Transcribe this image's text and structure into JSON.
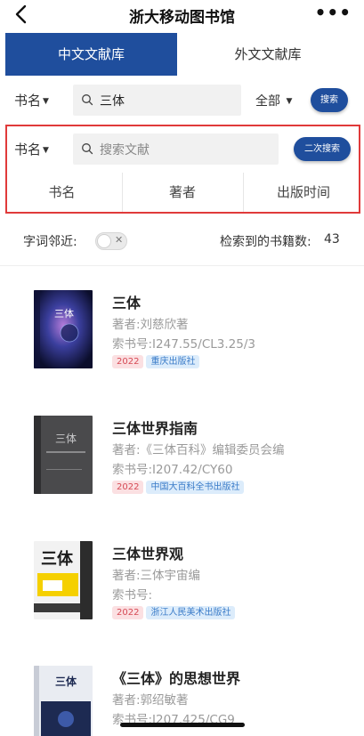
{
  "header": {
    "title": "浙大移动图书馆",
    "more_label": "•••"
  },
  "tabs": [
    {
      "label": "中文文献库",
      "active": true
    },
    {
      "label": "外文文献库",
      "active": false
    }
  ],
  "search": {
    "field": "书名",
    "query": "三体",
    "scope": "全部",
    "button": "搜索"
  },
  "secondary_search": {
    "field": "书名",
    "placeholder": "搜索文献",
    "button": "二次搜索",
    "sort_options": [
      "书名",
      "著者",
      "出版时间"
    ]
  },
  "options": {
    "proximity_label": "字词邻近:",
    "proximity_enabled": false,
    "result_count_label": "检索到的书籍数:",
    "result_count": "43"
  },
  "books": [
    {
      "title": "三体",
      "author": "著者:刘慈欣著",
      "call_number": "索书号:I247.55/CL3.25/3",
      "year": "2022",
      "publisher": "重庆出版社",
      "cover_text": "三体"
    },
    {
      "title": "三体世界指南",
      "author": "著者:《三体百科》编辑委员会编",
      "call_number": "索书号:I207.42/CY60",
      "year": "2022",
      "publisher": "中国大百科全书出版社",
      "cover_text": "三体"
    },
    {
      "title": "三体世界观",
      "author": "著者:三体宇宙编",
      "call_number": "索书号:",
      "year": "2022",
      "publisher": "浙江人民美术出版社",
      "cover_text": "三体"
    },
    {
      "title": "《三体》的思想世界",
      "author": "著者:郭绍敏著",
      "call_number": "索书号:I207.425/CG9",
      "year": "",
      "publisher": "",
      "cover_text": "三体"
    }
  ],
  "colors": {
    "accent": "#1f4e9d",
    "highlight_border": "#e03a3a",
    "year_tag": "#d64a55",
    "publisher_tag": "#3a7bc8"
  }
}
